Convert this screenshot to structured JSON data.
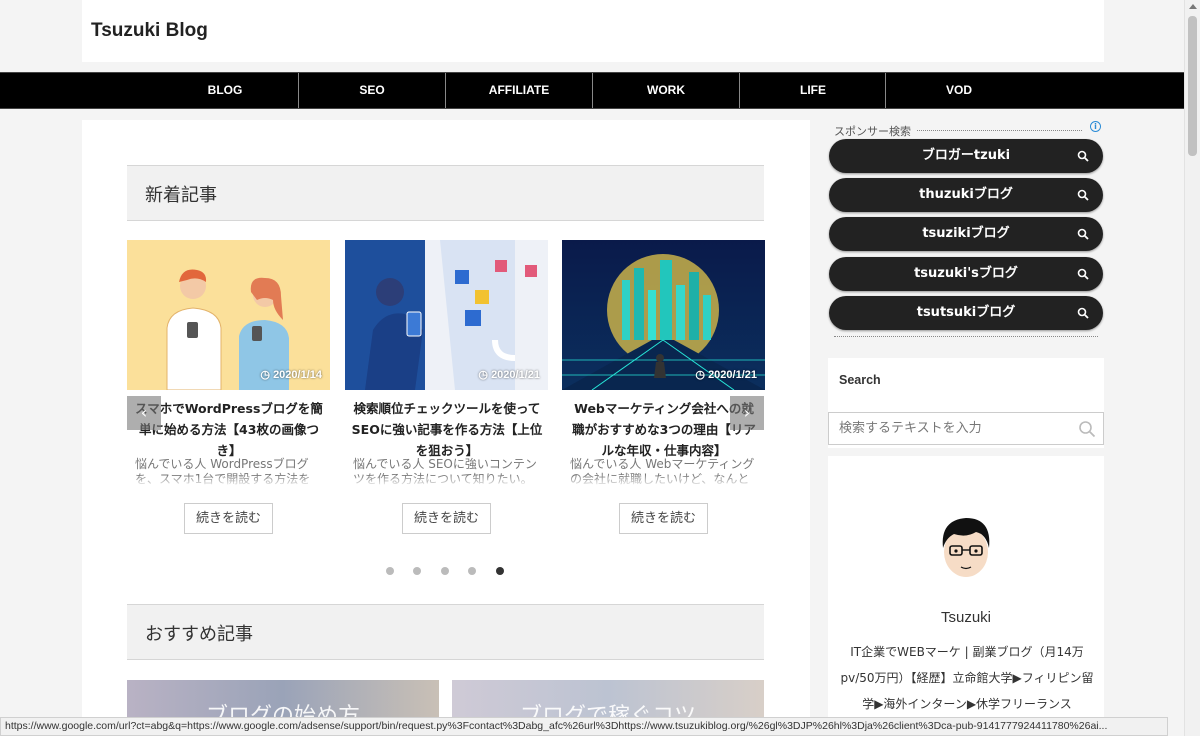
{
  "header": {
    "site_title": "Tsuzuki Blog"
  },
  "nav": {
    "items": [
      "BLOG",
      "SEO",
      "AFFILIATE",
      "WORK",
      "LIFE",
      "VOD"
    ]
  },
  "main": {
    "new_heading": "新着記事",
    "recommended_heading": "おすすめ記事",
    "cards": [
      {
        "date": "2020/1/14",
        "title": "スマホでWordPressブログを簡単に始める方法【43枚の画像つき】",
        "excerpt": "悩んでいる人 WordPressブログを、スマホ1台で開設する方法を",
        "button": "続きを読む"
      },
      {
        "date": "2020/1/21",
        "title": "検索順位チェックツールを使ってSEOに強い記事を作る方法【上位を狙おう】",
        "excerpt": "悩んでいる人 SEOに強いコンテンツを作る方法について知りたい。",
        "button": "続きを読む"
      },
      {
        "date": "2020/1/21",
        "title": "Webマーケティング会社への就職がおすすめな3つの理由【リアルな年収・仕事内容】",
        "excerpt": "悩んでいる人 Webマーケティングの会社に就職したいけど、なんと",
        "button": "続きを読む"
      }
    ],
    "slider_dots": 5,
    "slider_active_index": 4,
    "recommended_thumbs": [
      "ブログの始め方",
      "ブログで稼ぐコツ"
    ]
  },
  "sidebar": {
    "sponsor_label": "スポンサー検索",
    "sponsor_links": [
      "ブロガーtzuki",
      "thuzukiブログ",
      "tsuzikiブログ",
      "tsuzuki'sブログ",
      "tsutsukiブログ"
    ],
    "search_title": "Search",
    "search_placeholder": "検索するテキストを入力",
    "profile_name": "Tsuzuki",
    "profile_bio": "IT企業でWEBマーケ | 副業ブログ（月14万pv/50万円）【経歴】立命館大学▶フィリピン留学▶海外インターン▶休学フリーランス"
  },
  "statusbar": {
    "url": "https://www.google.com/url?ct=abg&q=https://www.google.com/adsense/support/bin/request.py%3Fcontact%3Dabg_afc%26url%3Dhttps://www.tsuzukiblog.org/%26gl%3DJP%26hl%3Dja%26client%3Dca-pub-9141777924411780%26ai..."
  },
  "colors": {
    "nav_bg": "#000000",
    "pill_bg": "#222222",
    "accent_blue": "#2a8bd6"
  }
}
